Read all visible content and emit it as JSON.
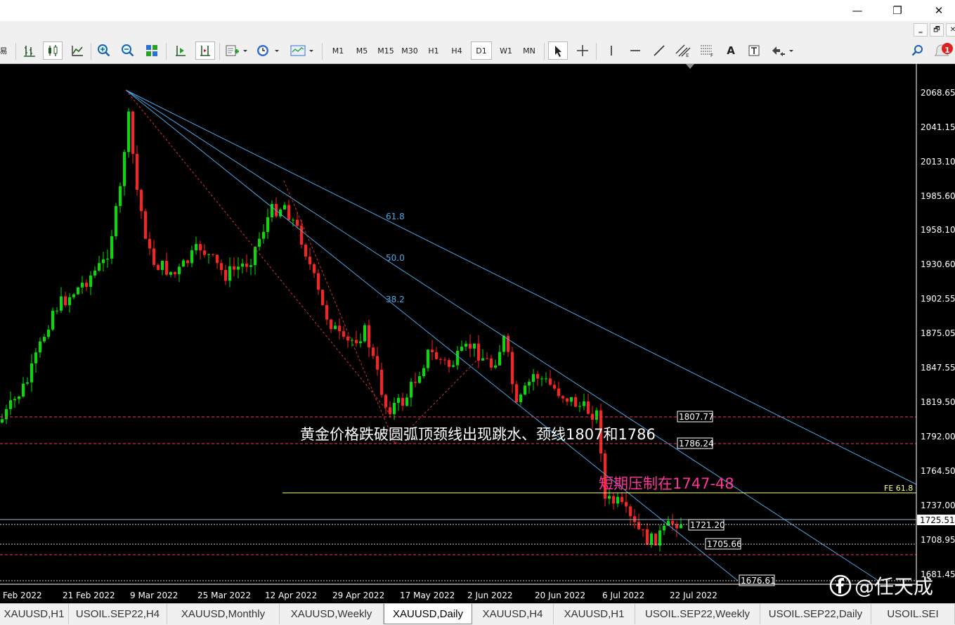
{
  "window": {
    "minimize": "—",
    "restore": "❐",
    "close": "✕"
  },
  "mdi": {
    "minimize": "‗",
    "restore": "🗗",
    "close": "✕"
  },
  "toolbar": {
    "left_glyph": "易",
    "timeframes": [
      "M1",
      "M5",
      "M15",
      "M30",
      "H1",
      "H4",
      "D1",
      "W1",
      "MN"
    ],
    "active_timeframe": "D1",
    "text_tool": "A",
    "notification_count": "1"
  },
  "chart": {
    "symbol": "XAUUSD",
    "period": "Daily",
    "price_labels": [
      "2068.65",
      "2041.15",
      "2013.10",
      "1985.60",
      "1958.10",
      "1930.60",
      "1902.55",
      "1875.05",
      "1847.55",
      "1819.50",
      "1792.00",
      "1764.50",
      "1737.00",
      "1708.95",
      "1681.45"
    ],
    "current_price": "1725.51",
    "date_labels": [
      "Feb 2022",
      "21 Feb 2022",
      "9 Mar 2022",
      "25 Mar 2022",
      "12 Apr 2022",
      "29 Apr 2022",
      "17 May 2022",
      "2 Jun 2022",
      "20 Jun 2022",
      "6 Jul 2022",
      "22 Jul 2022"
    ],
    "levels": [
      {
        "label": "1807.77",
        "color": "#ff3366",
        "style": "dashed"
      },
      {
        "label": "1786.24",
        "color": "#ff3366",
        "style": "dashed"
      },
      {
        "label": "1721.20",
        "color": "#ffffff",
        "style": "dotted"
      },
      {
        "label": "1705.66",
        "color": "#ffffff",
        "style": "dotted"
      },
      {
        "label": "1676.61",
        "color": "#ffffff",
        "style": "dotted"
      }
    ],
    "fib_labels": [
      "61.8",
      "50.0",
      "38.2"
    ],
    "fe_label": "FE 61.8",
    "annotation_white": "黄金价格跌破圆弧顶颈线出现跳水、颈线1807和1786",
    "annotation_pink": "短期压制在1747-48",
    "colors": {
      "bull": "#00e000",
      "bear": "#ff2020",
      "fib": "#4aa8e8",
      "level": "#ff3366",
      "fe": "#ffff80",
      "annotation_pink": "#ff3399"
    }
  },
  "tabs": [
    {
      "label": "XAUUSD,H1"
    },
    {
      "label": "USOIL.SEP22,H4"
    },
    {
      "label": "XAUUSD,Monthly"
    },
    {
      "label": "XAUUSD,Weekly"
    },
    {
      "label": "XAUUSD,Daily",
      "active": true
    },
    {
      "label": "XAUUSD,H4"
    },
    {
      "label": "XAUUSD,H1"
    },
    {
      "label": "USOIL.SEP22,Weekly"
    },
    {
      "label": "USOIL.SEP22,Daily"
    },
    {
      "label": "USOIL.SEI"
    }
  ],
  "watermark": {
    "text": "@任天成",
    "icon": "facebook-icon"
  }
}
